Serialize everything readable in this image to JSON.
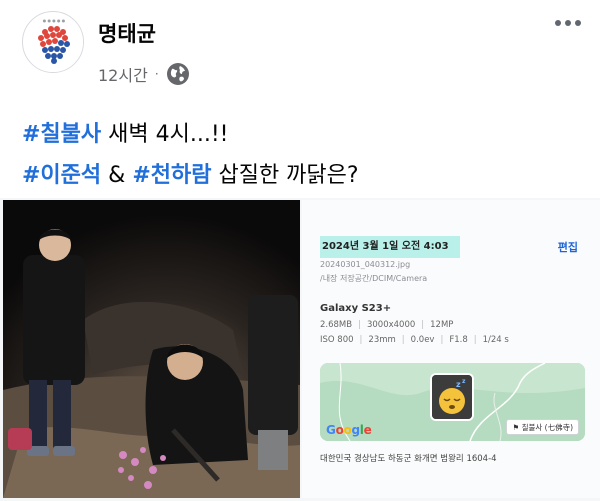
{
  "post": {
    "author": "명태균",
    "time": "12시간",
    "separator": "·",
    "audience_icon": "globe-icon",
    "more_icon": "more-options-icon"
  },
  "text": {
    "line1_tag": "#칠불사",
    "line1_rest": " 새벽 4시...!!",
    "line2_tag1": "#이준석",
    "line2_mid": " & ",
    "line2_tag2": "#천하람",
    "line2_rest": " 삽질한 까닭은?"
  },
  "photo_info": {
    "date": "2024년 3월 1일 오전 4:03",
    "edit": "편집",
    "filename": "20240301_040312.jpg",
    "path": "/내장 저장공간/DCIM/Camera",
    "device": "Galaxy S23+",
    "specs_row1": [
      "2.68MB",
      "3000x4000",
      "12MP"
    ],
    "specs_row2": [
      "ISO 800",
      "23mm",
      "0.0ev",
      "F1.8",
      "1/24 s"
    ],
    "map_logo": "Google",
    "location_tag": "칠불사 (七佛寺)",
    "address": "대한민국 경상남도 하동군 화개면 범왕리 1604-4"
  },
  "colors": {
    "hashtag": "#216fdb",
    "date_highlight": "#b9f0ea",
    "edit_link": "#1f65d6"
  }
}
